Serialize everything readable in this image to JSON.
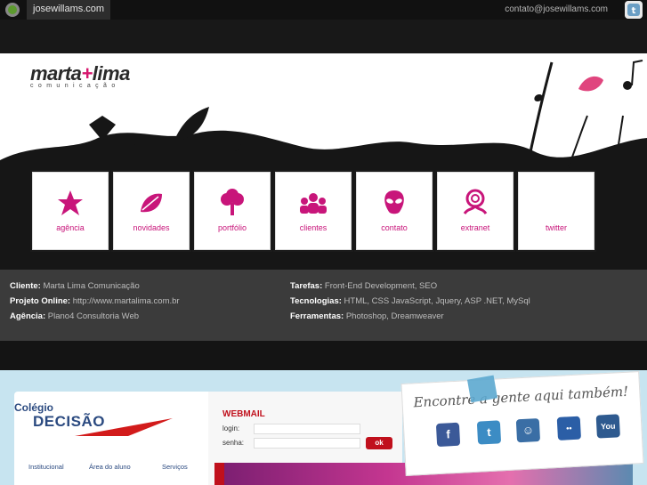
{
  "topbar": {
    "site": "josewillams.com",
    "contact": "contato@josewillams.com"
  },
  "hero": {
    "brand": {
      "name_left": "marta",
      "plus": "+",
      "name_right": "lima",
      "tagline": "comunicação"
    },
    "nav": [
      {
        "label": "agência",
        "icon": "flower-icon"
      },
      {
        "label": "novidades",
        "icon": "leaf-icon"
      },
      {
        "label": "portfólio",
        "icon": "tree-icon"
      },
      {
        "label": "clientes",
        "icon": "people-icon"
      },
      {
        "label": "contato",
        "icon": "alien-icon"
      },
      {
        "label": "extranet",
        "icon": "spiral-icon"
      },
      {
        "label": "twitter",
        "icon": "bird-icon"
      }
    ]
  },
  "info": {
    "cliente": {
      "label": "Cliente:",
      "value": "Marta Lima Comunicação"
    },
    "projeto": {
      "label": "Projeto Online:",
      "value": "http://www.martalima.com.br"
    },
    "agencia": {
      "label": "Agência:",
      "value": "Plano4 Consultoria Web"
    },
    "tarefas": {
      "label": "Tarefas:",
      "value": "Front-End Development, SEO"
    },
    "tecnologias": {
      "label": "Tecnologias:",
      "value": "HTML, CSS JavaScript, Jquery, ASP .NET, MySql"
    },
    "ferramentas": {
      "label": "Ferramentas:",
      "value": "Photoshop, Dreamweaver"
    }
  },
  "preview": {
    "logo_line1": "Colégio",
    "logo_line2": "DECISÃO",
    "menu": [
      "Institucional",
      "Área do aluno",
      "Serviços"
    ],
    "webmail": "WEBMAIL",
    "login_label": "login:",
    "senha_label": "senha:",
    "ok": "ok",
    "note_title": "Encontre a gente aqui também!",
    "social": [
      {
        "glyph": "f",
        "icon": "facebook-icon"
      },
      {
        "glyph": "t",
        "icon": "twitter-icon"
      },
      {
        "glyph": "☺",
        "icon": "orkut-icon"
      },
      {
        "glyph": "••",
        "icon": "flickr-icon"
      },
      {
        "glyph": "You",
        "icon": "youtube-icon"
      }
    ]
  },
  "colors": {
    "accent": "#d6176d",
    "dark": "#161616",
    "info_bg": "#3b3b3b"
  }
}
